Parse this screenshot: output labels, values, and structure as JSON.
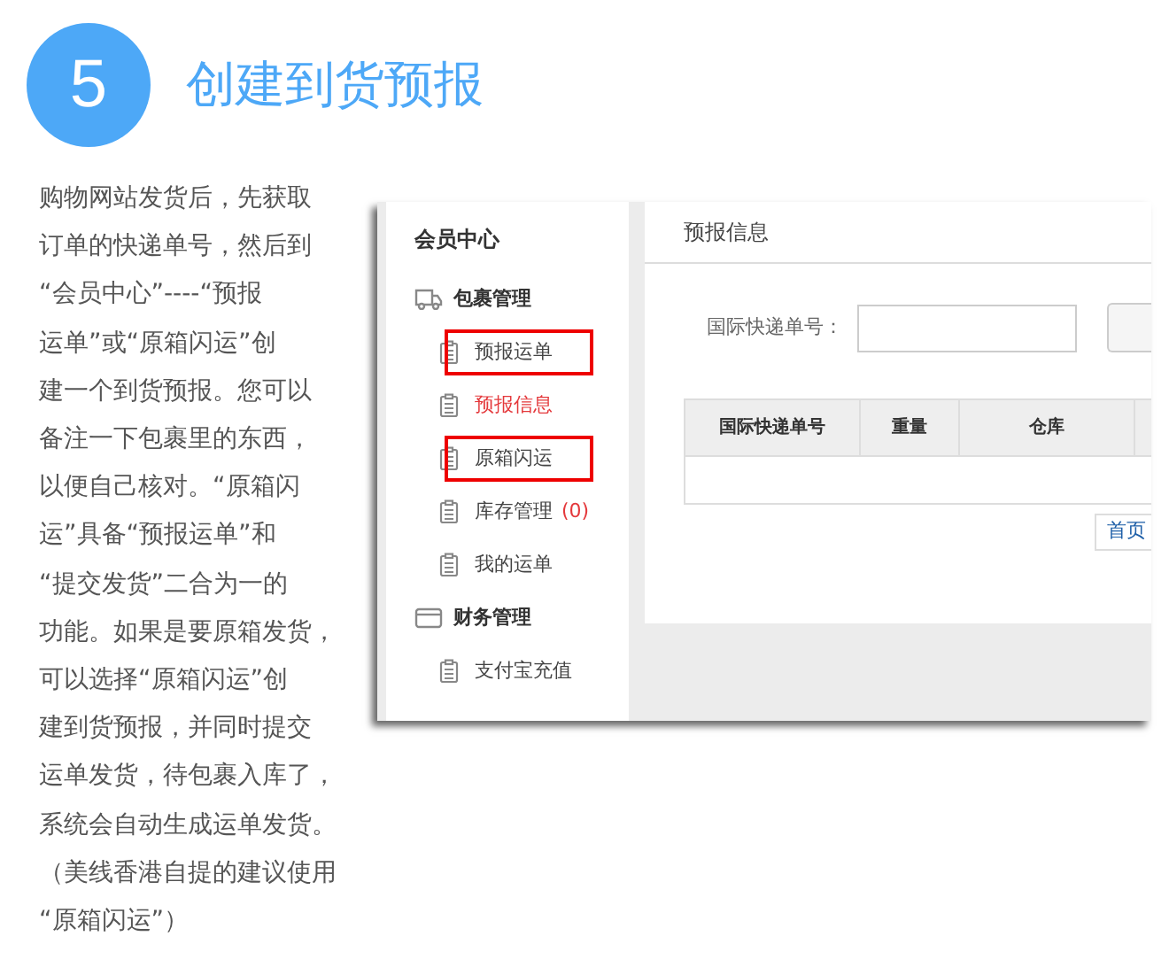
{
  "step": {
    "number": "5",
    "title": "创建到货预报"
  },
  "description": {
    "lines": [
      "购物网站发货后，先获取",
      "订单的快递单号，然后到",
      "“会员中心”----“预报",
      "运单”或“原箱闪运”创",
      "建一个到货预报。您可以",
      "备注一下包裹里的东西，",
      "以便自己核对。“原箱闪",
      "运”具备“预报运单”和",
      "“提交发货”二合为一的",
      "功能。如果是要原箱发货，",
      "可以选择“原箱闪运”创",
      "建到货预报，并同时提交",
      "运单发货，待包裹入库了，",
      "系统会自动生成运单发货。",
      "（美线香港自提的建议使用",
      "“原箱闪运”）"
    ]
  },
  "screenshot": {
    "sidebar": {
      "title": "会员中心",
      "groups": [
        {
          "label": "包裹管理",
          "items": [
            {
              "label": "预报运单",
              "selected": false,
              "highlighted": true
            },
            {
              "label": "预报信息",
              "selected": true,
              "highlighted": false
            },
            {
              "label": "原箱闪运",
              "selected": false,
              "highlighted": true
            },
            {
              "label": "库存管理",
              "count": "(0)",
              "selected": false,
              "highlighted": false
            },
            {
              "label": "我的运单",
              "selected": false,
              "highlighted": false
            }
          ]
        },
        {
          "label": "财务管理",
          "items": [
            {
              "label": "支付宝充值",
              "selected": false,
              "highlighted": false
            }
          ]
        }
      ]
    },
    "panel": {
      "title": "预报信息",
      "search_label": "国际快递单号：",
      "table": {
        "columns": [
          "国际快递单号",
          "重量",
          "仓库"
        ]
      },
      "pagination": [
        "首页"
      ]
    }
  }
}
